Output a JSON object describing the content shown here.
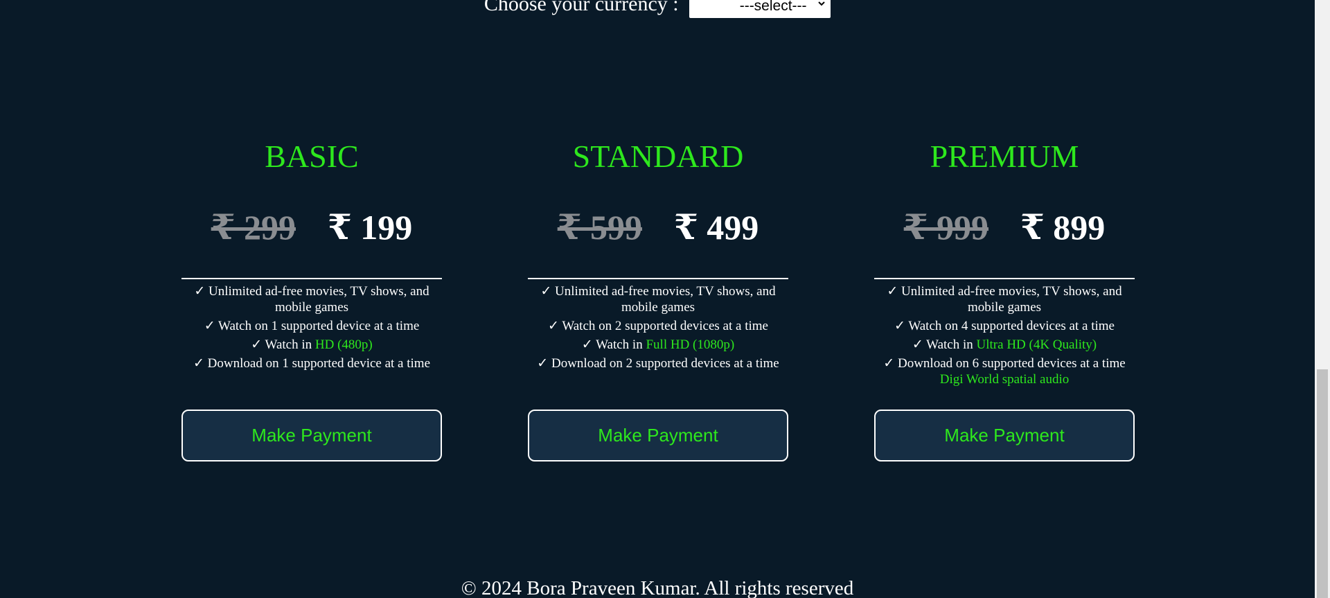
{
  "currency": {
    "label": "Choose your currency :",
    "select_value": "---select---"
  },
  "plans": [
    {
      "name": "BASIC",
      "old_price": "₹ 299",
      "new_price": "₹ 199",
      "features": {
        "f1": "✓ Unlimited ad-free movies, TV shows, and mobile games",
        "f2": "✓ Watch on 1 supported device at a time",
        "f3_prefix": "✓ Watch in ",
        "f3_highlight": "HD (480p)",
        "f4": "✓ Download on 1 supported device at a time"
      },
      "extra": "",
      "button": "Make Payment"
    },
    {
      "name": "STANDARD",
      "old_price": "₹ 599",
      "new_price": "₹ 499",
      "features": {
        "f1": "✓ Unlimited ad-free movies, TV shows, and mobile games",
        "f2": "✓ Watch on 2 supported devices at a time",
        "f3_prefix": "✓ Watch in ",
        "f3_highlight": "Full HD (1080p)",
        "f4": "✓ Download on 2 supported devices at a time"
      },
      "extra": "",
      "button": "Make Payment"
    },
    {
      "name": "PREMIUM",
      "old_price": "₹ 999",
      "new_price": "₹ 899",
      "features": {
        "f1": "✓ Unlimited ad-free movies, TV shows, and mobile games",
        "f2": "✓ Watch on 4 supported devices at a time",
        "f3_prefix": "✓ Watch in ",
        "f3_highlight": "Ultra HD (4K Quality)",
        "f4": "✓ Download on 6 supported devices at a time"
      },
      "extra": "Digi World spatial audio",
      "button": "Make Payment"
    }
  ],
  "footer": {
    "text": "© 2024 Bora Praveen Kumar. All rights reserved"
  },
  "colors": {
    "background": "#091a28",
    "accent": "#2ee81d",
    "button_bg": "#162e44",
    "strike": "#8a8d91"
  }
}
